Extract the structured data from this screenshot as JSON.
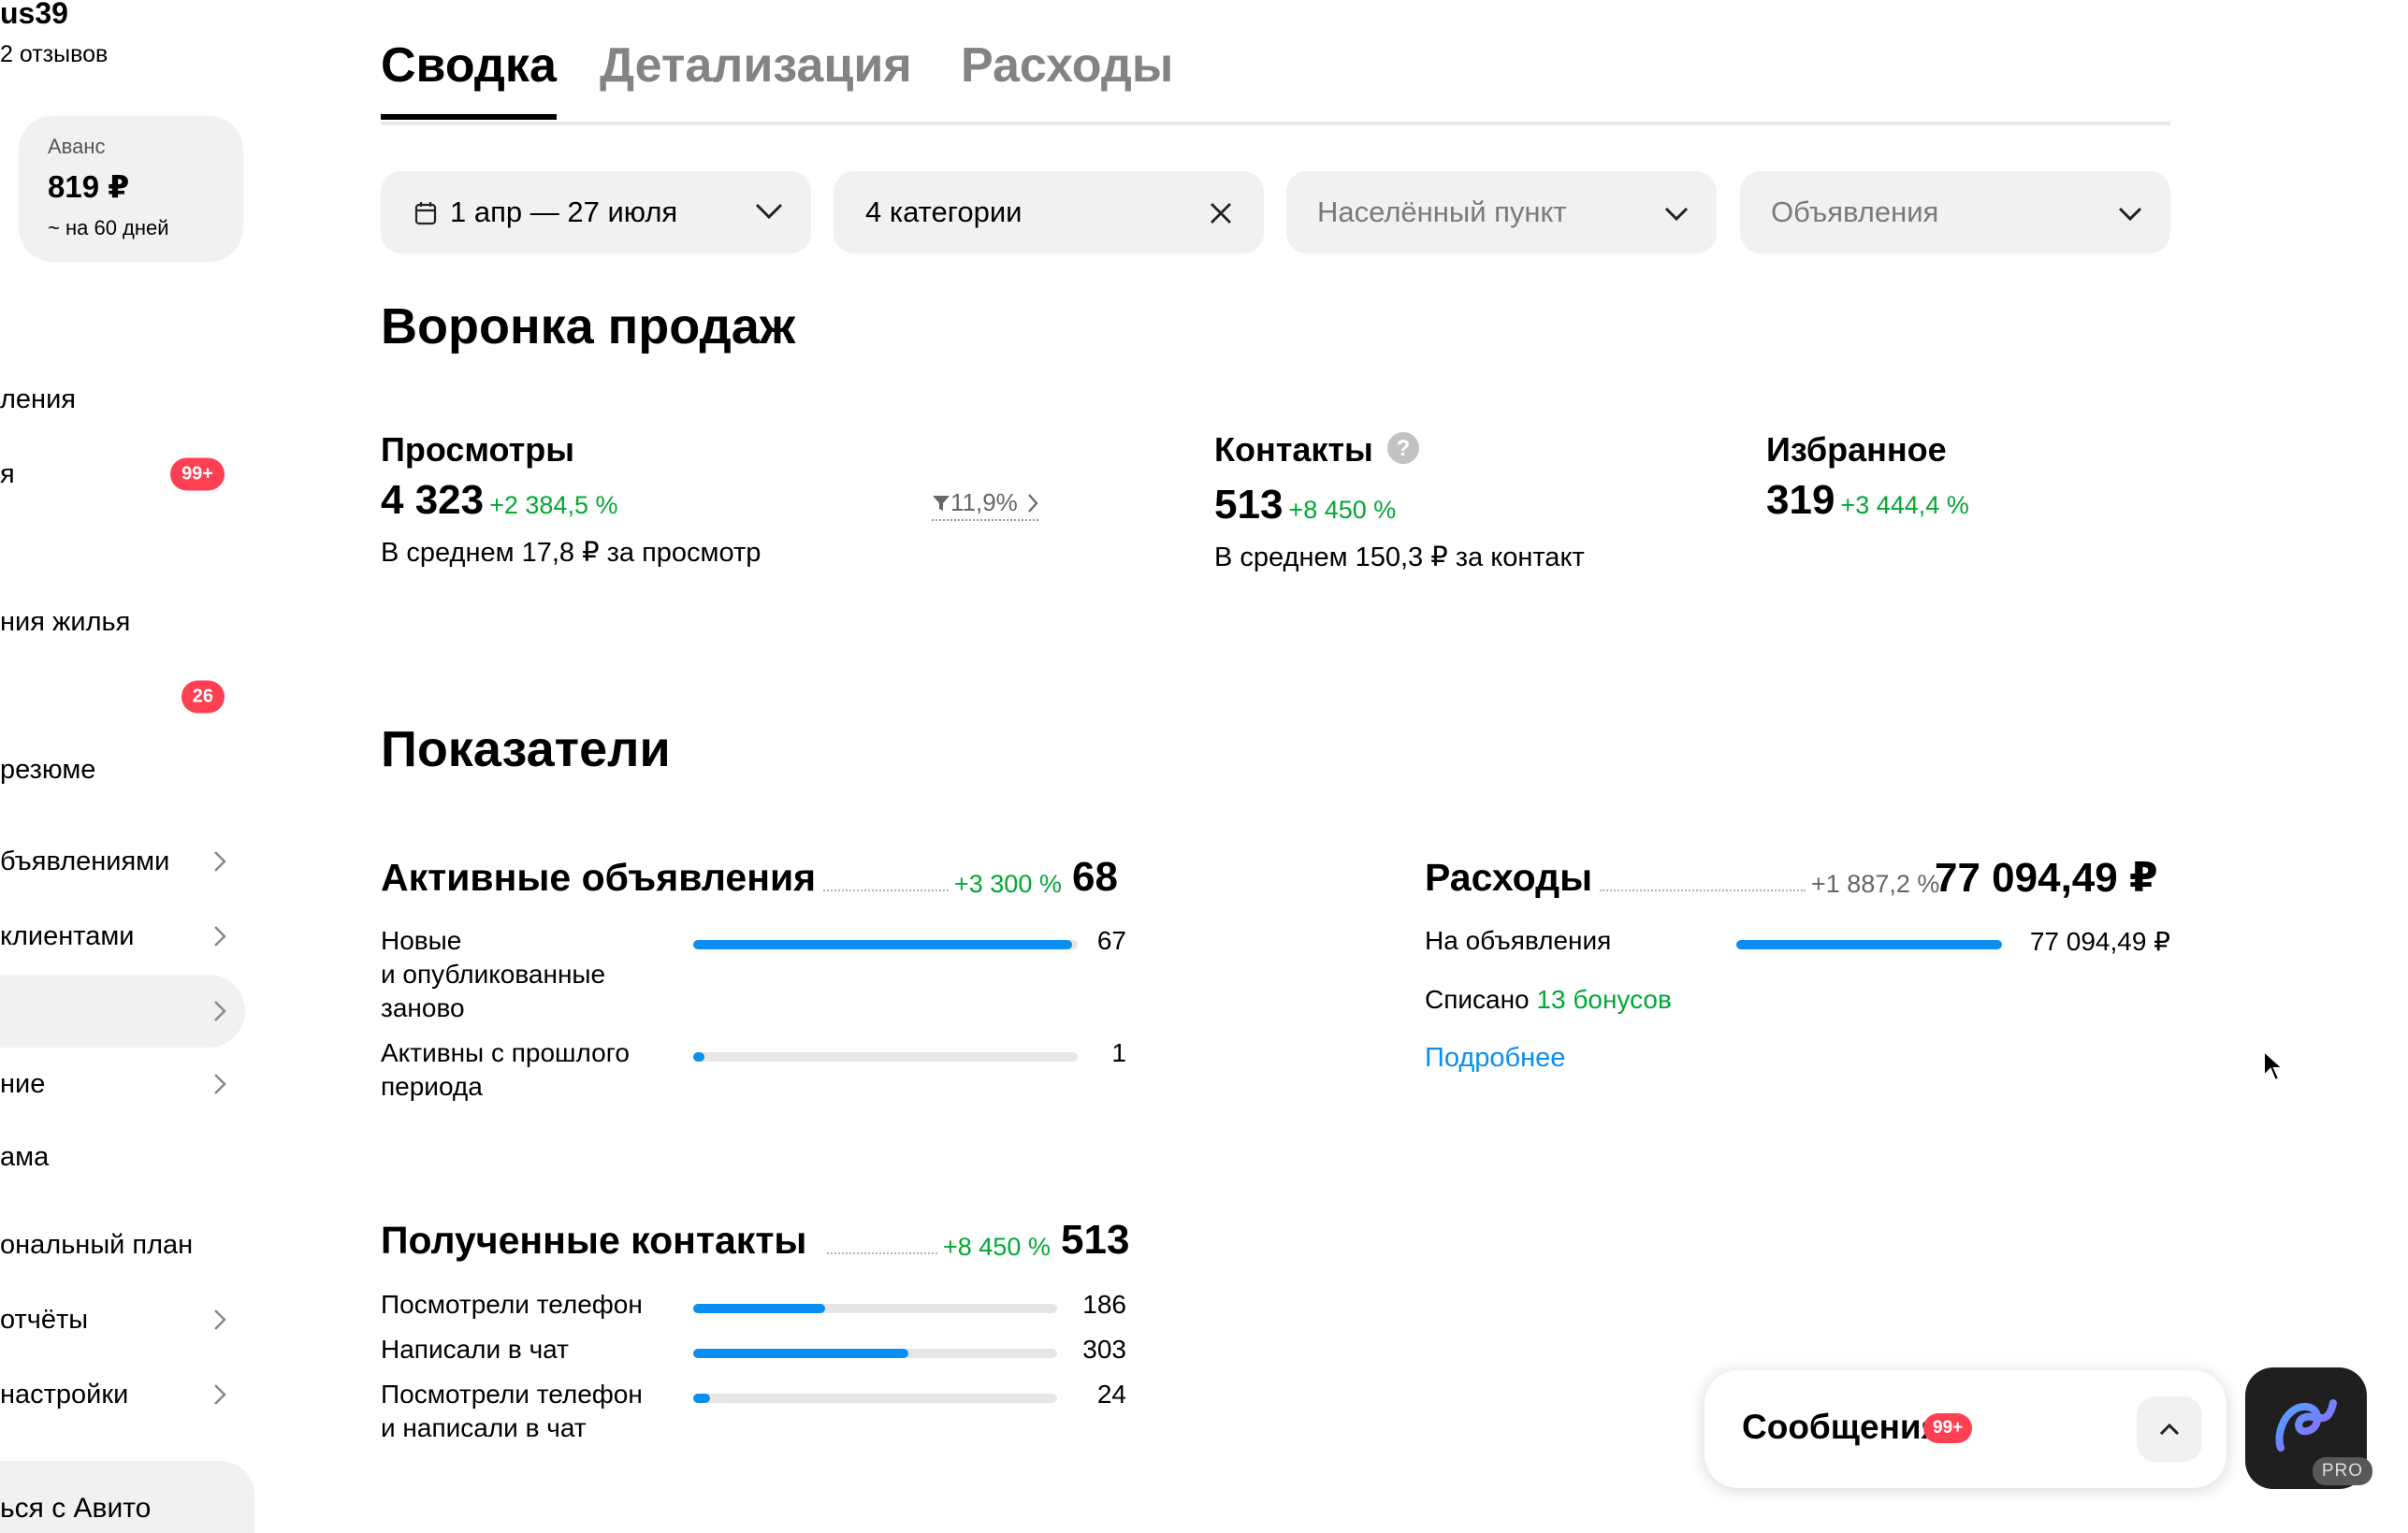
{
  "sidebar": {
    "username": "us39",
    "reviews": "2 отзывов",
    "avans": {
      "label": "Аванс",
      "amount": "819 ₽",
      "sub": "~ на 60 дней"
    },
    "items": [
      {
        "label": "ления"
      },
      {
        "label": "я",
        "badge": "99+"
      },
      {
        "label": "ния жилья"
      },
      {
        "label": "",
        "badge": "26"
      },
      {
        "label": " резюме"
      },
      {
        "label": "бъявлениями"
      },
      {
        "label": " клиентами"
      },
      {
        "label": ""
      },
      {
        "label": "ние"
      },
      {
        "label": "ама"
      },
      {
        "label": "ональный план"
      },
      {
        "label": " отчёты"
      },
      {
        "label": " настройки"
      }
    ],
    "bottom": "ься с Авито"
  },
  "tabs": [
    "Сводка",
    "Детализация",
    "Расходы"
  ],
  "filters": {
    "date": "1 апр — 27 июля",
    "categories": "4 категории",
    "city_placeholder": "Населённый пункт",
    "ads_placeholder": "Объявления"
  },
  "funnel": {
    "title": "Воронка продаж",
    "views": {
      "title": "Просмотры",
      "value": "4 323",
      "delta": "+2 384,5 %",
      "sub": "В среднем 17,8 ₽ за просмотр",
      "conversion": "11,9%"
    },
    "contacts": {
      "title": "Контакты",
      "value": "513",
      "delta": "+8 450 %",
      "sub": "В среднем 150,3 ₽ за контакт"
    },
    "favorites": {
      "title": "Избранное",
      "value": "319",
      "delta": "+3 444,4 %"
    }
  },
  "indicators": {
    "title": "Показатели",
    "active_ads": {
      "title": "Активные объявления",
      "delta": "+3 300 %",
      "total": "68",
      "rows": [
        {
          "label": "Новые\nи опубликованные\nзаново",
          "value": "67",
          "fraction": 0.985
        },
        {
          "label": "Активны с прошлого\nпериода",
          "value": "1",
          "fraction": 0.03
        }
      ]
    },
    "expenses": {
      "title": "Расходы",
      "delta": "+1 887,2 %",
      "total": "77 094,49 ₽",
      "rows": [
        {
          "label": "На объявления",
          "value": "77 094,49 ₽",
          "fraction": 1.0
        }
      ],
      "written_off_label": "Списано",
      "bonuses": "13 бонусов",
      "more_link": "Подробнее"
    },
    "contacts_received": {
      "title": "Полученные контакты",
      "delta": "+8 450 %",
      "total": "513",
      "rows": [
        {
          "label": "Посмотрели телефон",
          "value": "186",
          "fraction": 0.363
        },
        {
          "label": "Написали в чат",
          "value": "303",
          "fraction": 0.591
        },
        {
          "label": "Посмотрели телефон\nи написали в чат",
          "value": "24",
          "fraction": 0.047
        }
      ]
    }
  },
  "messages": {
    "title": "Сообщения",
    "badge": "99+"
  },
  "pro": {
    "label": "PRO"
  },
  "colors": {
    "accent": "#0a8ff0",
    "positive": "#02a835",
    "badge": "#ff4053",
    "chip_bg": "#f2f1f0"
  },
  "icons": [
    "calendar-icon",
    "chevron-down-icon",
    "close-icon",
    "filter-icon",
    "chevron-right-icon",
    "help-icon",
    "chevron-up-icon",
    "avito-pro-logo",
    "cursor-icon"
  ]
}
